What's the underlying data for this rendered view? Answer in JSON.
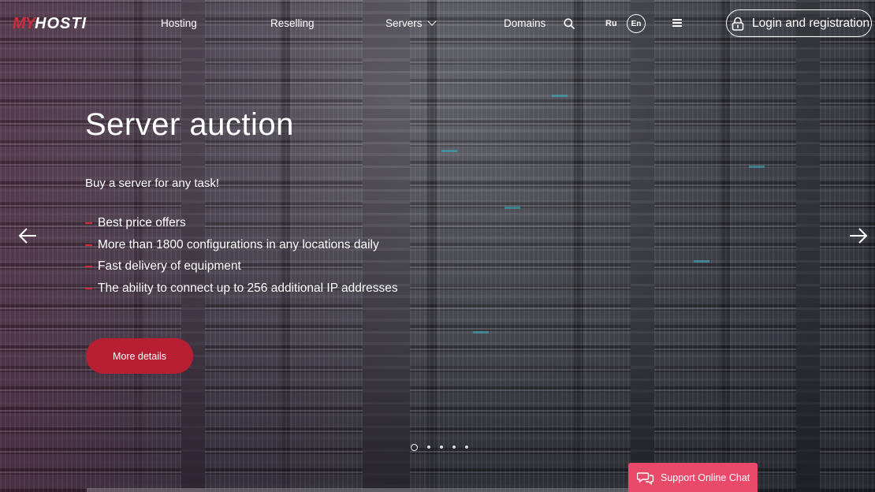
{
  "brand": {
    "logo_prefix": "MY",
    "logo_name": "HOSTI",
    "accent": "#d22b3c"
  },
  "nav": {
    "hosting": "Hosting",
    "reselling": "Reselling",
    "servers": "Servers",
    "domains": "Domains",
    "lang_ru": "Ru",
    "lang_en": "En",
    "login": "Login and registration"
  },
  "hero": {
    "title": "Server auction",
    "subtitle": "Buy a server for any task!",
    "features": [
      "Best price offers",
      "More than 1800 configurations in any locations daily",
      "Fast delivery of equipment",
      "The ability to connect up to 256 additional IP addresses"
    ],
    "cta": "More details"
  },
  "slider": {
    "total": 5,
    "active": 1
  },
  "chat": {
    "label": "Support Online Chat",
    "color": "#ea4a6a"
  },
  "icons": [
    "search-icon",
    "menu-icon",
    "lock-icon",
    "arrow-left-icon",
    "arrow-right-icon",
    "chat-icon"
  ]
}
